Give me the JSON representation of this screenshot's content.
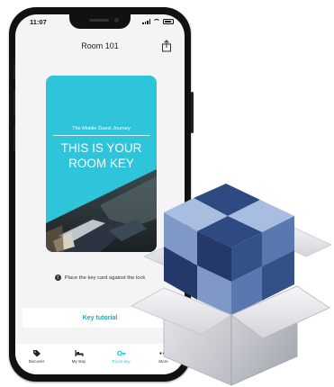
{
  "status_bar": {
    "time": "11:07"
  },
  "header": {
    "title": "Room 101",
    "share_icon": "share-icon"
  },
  "key_card": {
    "subtitle": "The Mobile Guest Journey",
    "headline_line1": "THIS IS YOUR",
    "headline_line2": "ROOM KEY",
    "color": "#2ec4d9"
  },
  "hint": {
    "icon": "info-icon",
    "text": "Place the key card against the lock"
  },
  "tutorial_button": {
    "label": "Key tutorial",
    "color": "#1aa8c8"
  },
  "tabbar": {
    "items": [
      {
        "label": "Discover",
        "icon": "tag-icon",
        "active": false
      },
      {
        "label": "My stay",
        "icon": "bed-icon",
        "active": false
      },
      {
        "label": "Room key",
        "icon": "key-icon",
        "active": true
      },
      {
        "label": "More",
        "icon": "more-icon",
        "active": false
      }
    ],
    "accent": "#2ec4d9"
  },
  "overlay": {
    "icon": "software-box-icon"
  }
}
